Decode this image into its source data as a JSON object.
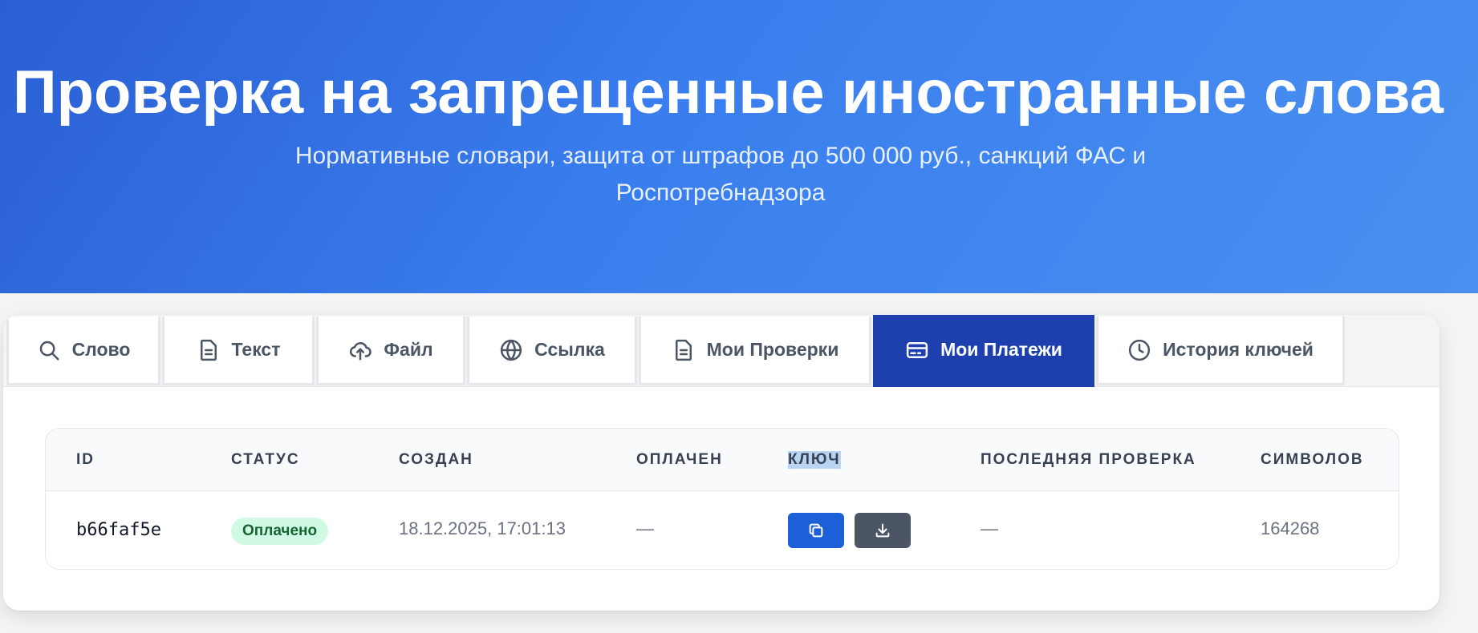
{
  "hero": {
    "title": "Проверка на запрещенные иностранные слова",
    "subtitle_line1": "Нормативные словари, защита от штрафов до 500 000 руб., санкций ФАС и",
    "subtitle_line2": "Роспотребнадзора"
  },
  "tabs": [
    {
      "label": "Слово",
      "icon": "search-icon"
    },
    {
      "label": "Текст",
      "icon": "document-icon"
    },
    {
      "label": "Файл",
      "icon": "cloud-upload-icon"
    },
    {
      "label": "Ссылка",
      "icon": "globe-icon"
    },
    {
      "label": "Мои Проверки",
      "icon": "document-icon"
    },
    {
      "label": "Мои Платежи",
      "icon": "credit-card-icon",
      "active": true
    },
    {
      "label": "История ключей",
      "icon": "clock-icon"
    }
  ],
  "table": {
    "headers": {
      "id": "ID",
      "status": "СТАТУС",
      "created": "СОЗДАН",
      "paid": "ОПЛАЧЕН",
      "key": "КЛЮЧ",
      "last_check": "ПОСЛЕДНЯЯ ПРОВЕРКА",
      "chars": "СИМВОЛОВ"
    },
    "rows": [
      {
        "id": "b66faf5e",
        "status": "Оплачено",
        "created": "18.12.2025, 17:01:13",
        "paid": "—",
        "key_actions": [
          "copy-icon",
          "download-icon"
        ],
        "last_check": "—",
        "chars": "164268"
      }
    ]
  },
  "colors": {
    "hero_gradient_start": "#2a5fd3",
    "hero_gradient_end": "#4a90f0",
    "active_tab": "#1e40af",
    "copy_button": "#1d5fd6",
    "download_button": "#4b5563",
    "badge_bg": "#d1fae5",
    "badge_text": "#166534"
  }
}
